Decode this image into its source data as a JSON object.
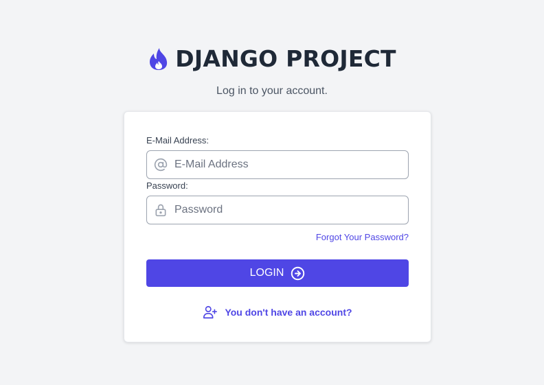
{
  "brand": {
    "title": "DJANGO PROJECT",
    "icon": "fire-icon",
    "accent_color": "#4f46e5"
  },
  "subtitle": "Log in to your account.",
  "form": {
    "email": {
      "label": "E-Mail Address:",
      "placeholder": "E-Mail Address",
      "value": "",
      "icon": "at-sign-icon"
    },
    "password": {
      "label": "Password:",
      "placeholder": "Password",
      "value": "",
      "icon": "lock-icon"
    },
    "forgot_link": "Forgot Your Password?",
    "login_button": {
      "label": "LOGIN",
      "icon": "arrow-circle-right-icon"
    },
    "signup_link": {
      "label": "You don't have an account?",
      "icon": "user-plus-icon"
    }
  }
}
